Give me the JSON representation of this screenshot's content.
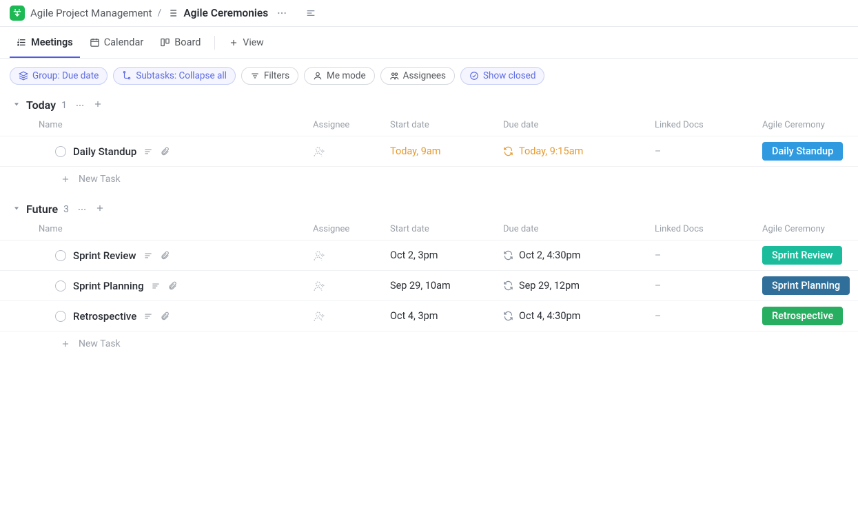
{
  "breadcrumb": {
    "space": "Agile Project Management",
    "list": "Agile Ceremonies"
  },
  "tabs": {
    "meetings": "Meetings",
    "calendar": "Calendar",
    "board": "Board",
    "add_view": "View"
  },
  "filters": {
    "group": "Group: Due date",
    "subtasks": "Subtasks: Collapse all",
    "filters": "Filters",
    "me_mode": "Me mode",
    "assignees": "Assignees",
    "show_closed": "Show closed"
  },
  "columns": {
    "name": "Name",
    "assignee": "Assignee",
    "start": "Start date",
    "due": "Due date",
    "docs": "Linked Docs",
    "ceremony": "Agile Ceremony"
  },
  "new_task_label": "New Task",
  "groups": [
    {
      "title": "Today",
      "count": "1",
      "tasks": [
        {
          "name": "Daily Standup",
          "start": "Today, 9am",
          "due": "Today, 9:15am",
          "docs": "–",
          "ceremony": "Daily Standup",
          "badge_color": "#2f9ae0",
          "today_style": true
        }
      ]
    },
    {
      "title": "Future",
      "count": "3",
      "tasks": [
        {
          "name": "Sprint Review",
          "start": "Oct 2, 3pm",
          "due": "Oct 2, 4:30pm",
          "docs": "–",
          "ceremony": "Sprint Review",
          "badge_color": "#1abc9c",
          "today_style": false
        },
        {
          "name": "Sprint Planning",
          "start": "Sep 29, 10am",
          "due": "Sep 29, 12pm",
          "docs": "–",
          "ceremony": "Sprint Planning",
          "badge_color": "#2f6f9a",
          "today_style": false
        },
        {
          "name": "Retrospective",
          "start": "Oct 4, 3pm",
          "due": "Oct 4, 4:30pm",
          "docs": "–",
          "ceremony": "Retrospective",
          "badge_color": "#27ae60",
          "today_style": false
        }
      ]
    }
  ]
}
